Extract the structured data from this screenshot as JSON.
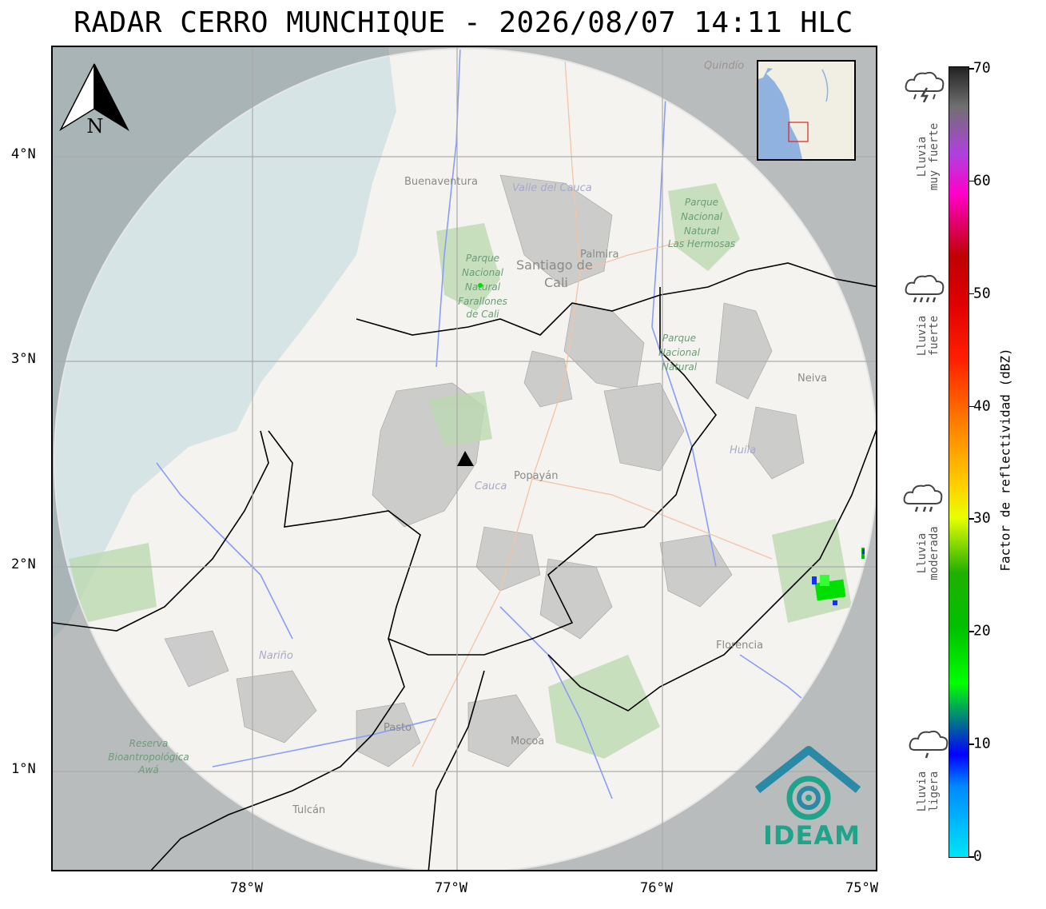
{
  "title": "RADAR CERRO MUNCHIQUE - 2026/08/07 14:11 HLC",
  "map": {
    "lat_ticks": [
      "4°N",
      "3°N",
      "2°N",
      "1°N"
    ],
    "lon_ticks": [
      "78°W",
      "77°W",
      "76°W",
      "75°W"
    ],
    "place_labels": {
      "buenaventura": "Buenaventura",
      "valle": "Valle del Cauca",
      "quindio": "Quindío",
      "palmira": "Palmira",
      "cali1": "Santiago de",
      "cali2": "Cali",
      "pnn_farallones": [
        "Parque",
        "Nacional",
        "Natural",
        "Farallones",
        "de Cali"
      ],
      "pnn_hermosas": [
        "Parque",
        "Nacional",
        "Natural",
        "Las Hermosas"
      ],
      "pnn_nevado": [
        "Parque",
        "Nacional",
        "Natural"
      ],
      "neiva": "Neiva",
      "huila": "Huila",
      "cauca": "Cauca",
      "popayan": "Popayán",
      "narino": "Nariño",
      "florencia": "Florencia",
      "pasto": "Pasto",
      "mocoa": "Mocoa",
      "tulcan": "Tulcán",
      "reserva": [
        "Reserva",
        "Bioantropológica",
        "Awá"
      ]
    },
    "north_label": "N",
    "radar_site_icon": "triangle-marker-icon"
  },
  "logo": {
    "text": "IDEAM",
    "icon": "ideam-logo-icon",
    "color": "#1fa38a"
  },
  "colorbar": {
    "title": "Factor de reflectividad (dBZ)",
    "min": 0,
    "max": 70,
    "ticks": [
      "0",
      "10",
      "20",
      "30",
      "40",
      "50",
      "60",
      "70"
    ],
    "categories": [
      {
        "label": [
          "Lluvia",
          "muy fuerte"
        ],
        "icon": "thunderstorm-icon"
      },
      {
        "label": [
          "Lluvia",
          "fuerte"
        ],
        "icon": "heavy-rain-icon"
      },
      {
        "label": [
          "Lluvia",
          "moderada"
        ],
        "icon": "moderate-rain-icon"
      },
      {
        "label": [
          "Lluvia",
          "ligera"
        ],
        "icon": "light-rain-icon"
      }
    ]
  }
}
